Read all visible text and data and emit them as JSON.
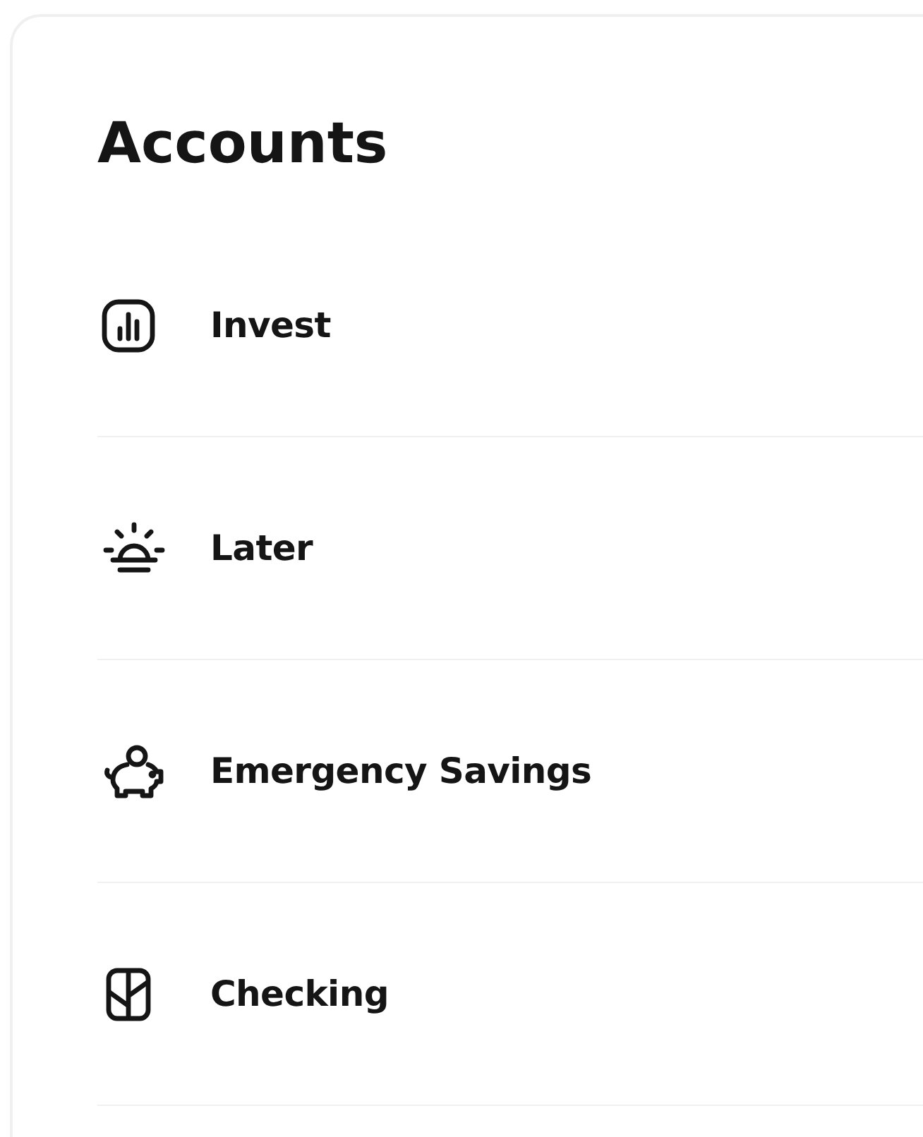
{
  "title": "Accounts",
  "accounts": [
    {
      "kind": "invest",
      "label": "Invest"
    },
    {
      "kind": "later",
      "label": "Later"
    },
    {
      "kind": "savings",
      "label": "Emergency Savings"
    },
    {
      "kind": "checking",
      "label": "Checking"
    }
  ]
}
